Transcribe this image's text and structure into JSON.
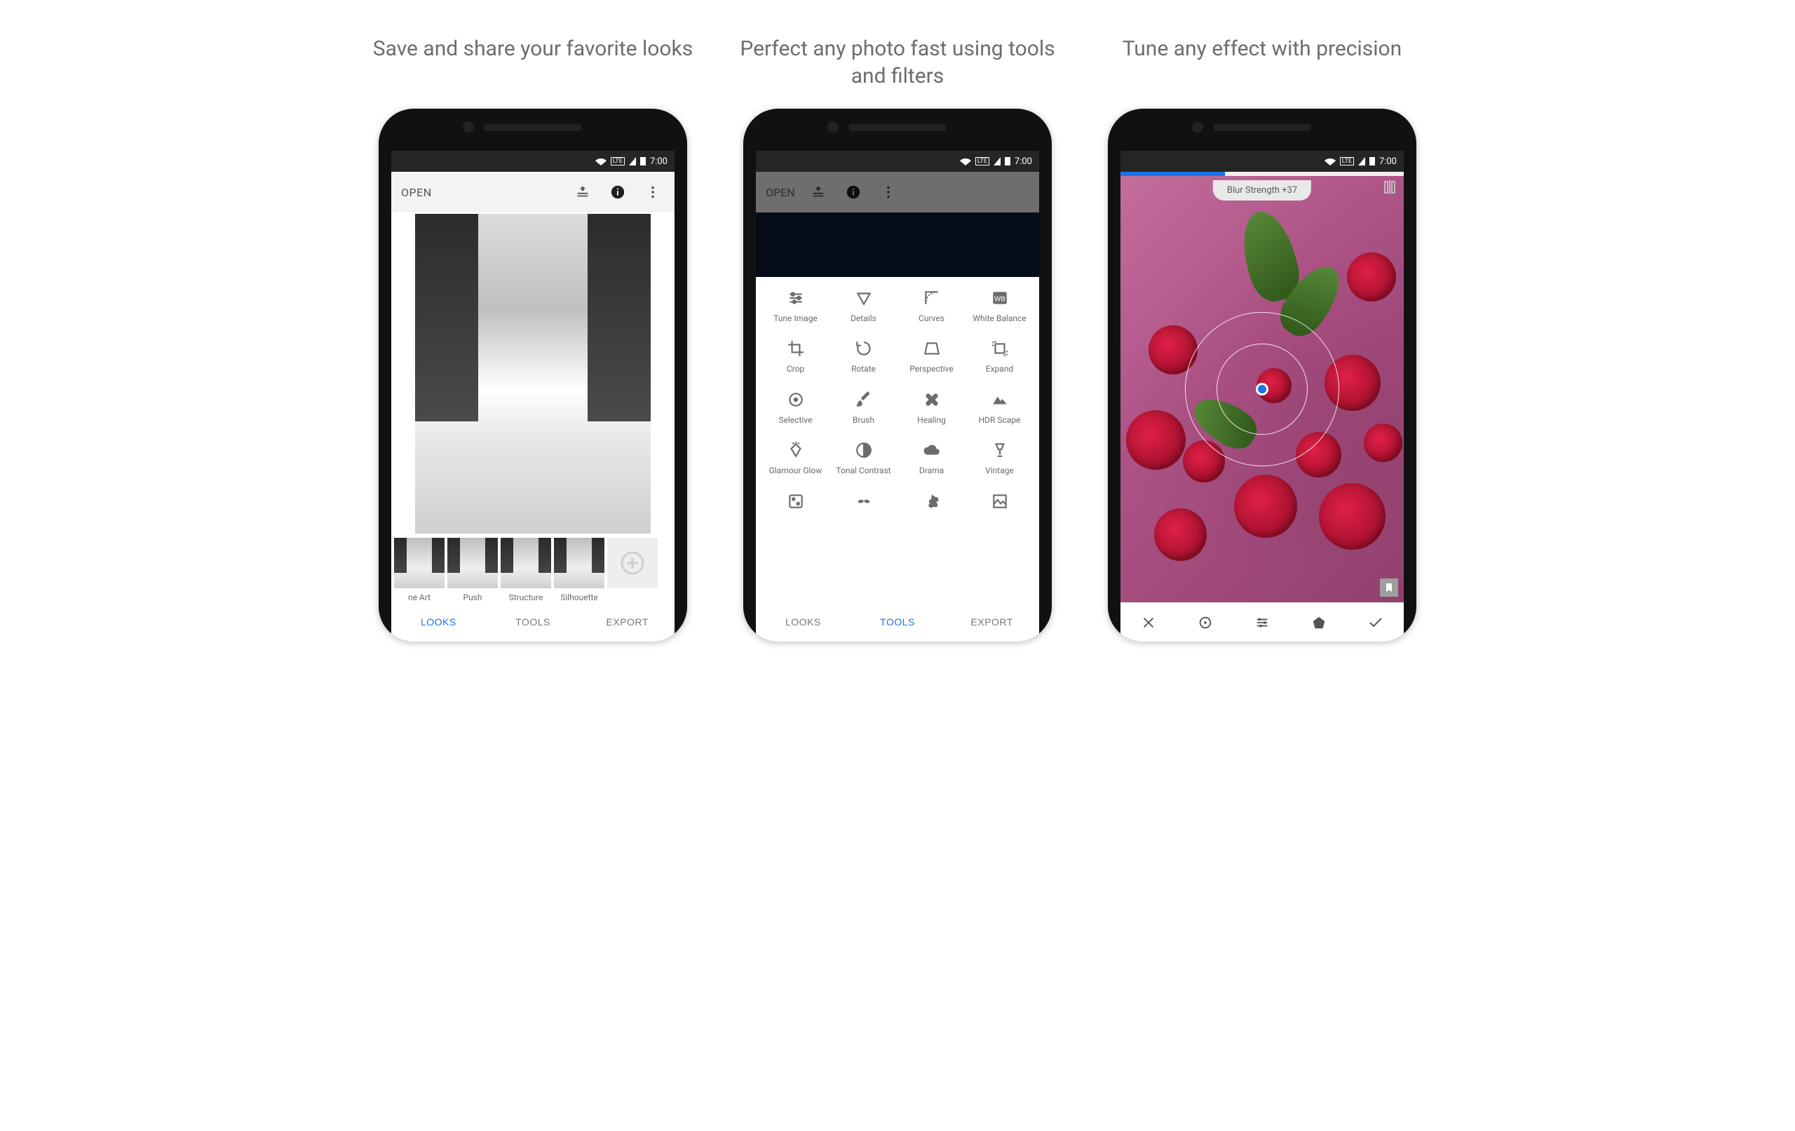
{
  "statusbar": {
    "time": "7:00",
    "lte": "LTE"
  },
  "panel1": {
    "caption": "Save and share your favorite looks",
    "open_label": "OPEN",
    "looks": {
      "items": [
        "ne Art",
        "Push",
        "Structure",
        "Silhouette"
      ]
    },
    "tabs": {
      "looks": "LOOKS",
      "tools": "TOOLS",
      "export": "EXPORT",
      "active": "looks"
    }
  },
  "panel2": {
    "caption": "Perfect any photo fast using tools and filters",
    "open_label": "OPEN",
    "tools": [
      "Tune Image",
      "Details",
      "Curves",
      "White Balance",
      "Crop",
      "Rotate",
      "Perspective",
      "Expand",
      "Selective",
      "Brush",
      "Healing",
      "HDR Scape",
      "Glamour Glow",
      "Tonal Contrast",
      "Drama",
      "Vintage"
    ],
    "extra_row_visible": true,
    "tabs": {
      "looks": "LOOKS",
      "tools": "TOOLS",
      "export": "EXPORT",
      "active": "tools"
    }
  },
  "panel3": {
    "caption": "Tune any effect with precision",
    "slider_label": "Blur Strength +37",
    "progress_pct": 37
  },
  "colors": {
    "accent": "#1a73e8"
  }
}
